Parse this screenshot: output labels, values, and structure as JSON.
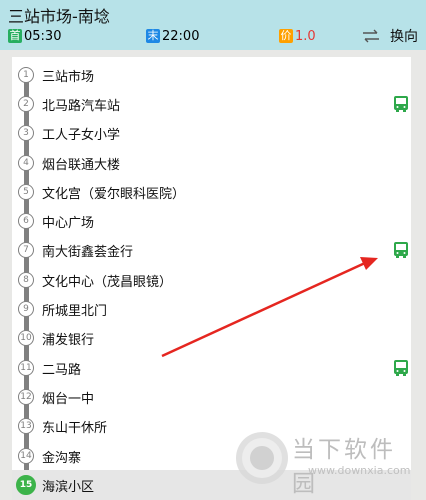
{
  "header": {
    "title": "三站市场-南埝",
    "first_badge": "首",
    "first_time": "05:30",
    "last_badge": "末",
    "last_time": "22:00",
    "price_badge": "价",
    "price": "1.0",
    "switch_label": "换向",
    "colors": {
      "first": "#27ae60",
      "last": "#1e88e5",
      "price": "#ffa000",
      "price_text": "#e53935"
    }
  },
  "stops": [
    {
      "num": "1",
      "name": "三站市场"
    },
    {
      "num": "2",
      "name": "北马路汽车站"
    },
    {
      "num": "3",
      "name": "工人子女小学"
    },
    {
      "num": "4",
      "name": "烟台联通大楼"
    },
    {
      "num": "5",
      "name": "文化宫（爱尔眼科医院）"
    },
    {
      "num": "6",
      "name": "中心广场"
    },
    {
      "num": "7",
      "name": "南大街鑫荟金行"
    },
    {
      "num": "8",
      "name": "文化中心（茂昌眼镜）"
    },
    {
      "num": "9",
      "name": "所城里北门"
    },
    {
      "num": "10",
      "name": "浦发银行"
    },
    {
      "num": "11",
      "name": "二马路"
    },
    {
      "num": "12",
      "name": "烟台一中"
    },
    {
      "num": "13",
      "name": "东山干休所"
    },
    {
      "num": "14",
      "name": "金沟寨"
    },
    {
      "num": "15",
      "name": "海滨小区"
    }
  ],
  "watermark": {
    "name": "当下软件园",
    "url": "www.downxia.com"
  }
}
